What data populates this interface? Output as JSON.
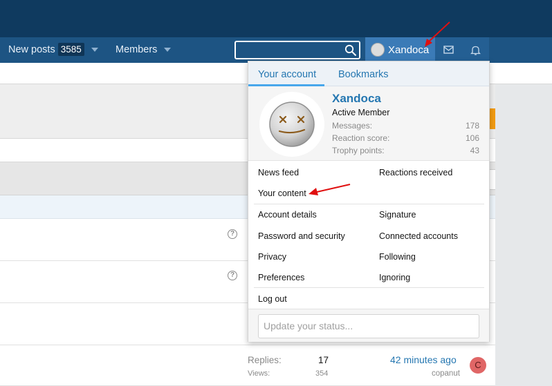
{
  "navbar": {
    "new_posts_label": "New posts",
    "new_posts_count": "3585",
    "members_label": "Members",
    "username": "Xandoca"
  },
  "search": {
    "placeholder": ""
  },
  "menu": {
    "tabs": [
      "Your account",
      "Bookmarks"
    ],
    "profile": {
      "name": "Xandoca",
      "title": "Active Member",
      "stats": [
        {
          "label": "Messages:",
          "value": "178"
        },
        {
          "label": "Reaction score:",
          "value": "106"
        },
        {
          "label": "Trophy points:",
          "value": "43"
        }
      ]
    },
    "links": {
      "news_feed": "News feed",
      "reactions_received": "Reactions received",
      "your_content": "Your content",
      "account_details": "Account details",
      "signature": "Signature",
      "password_security": "Password and security",
      "connected_accounts": "Connected accounts",
      "privacy": "Privacy",
      "following": "Following",
      "preferences": "Preferences",
      "ignoring": "Ignoring",
      "log_out": "Log out"
    },
    "status_placeholder": "Update your status..."
  },
  "thread_row": {
    "replies_label": "Replies:",
    "replies_value": "17",
    "views_label": "Views:",
    "views_value": "354",
    "last_time": "42 minutes ago",
    "last_user": "copanut",
    "avatar_letter": "C"
  },
  "colors": {
    "topbar": "#0f3a5f",
    "navbar": "#1d5483",
    "accent": "#2577b1",
    "arrow": "#e01010"
  }
}
